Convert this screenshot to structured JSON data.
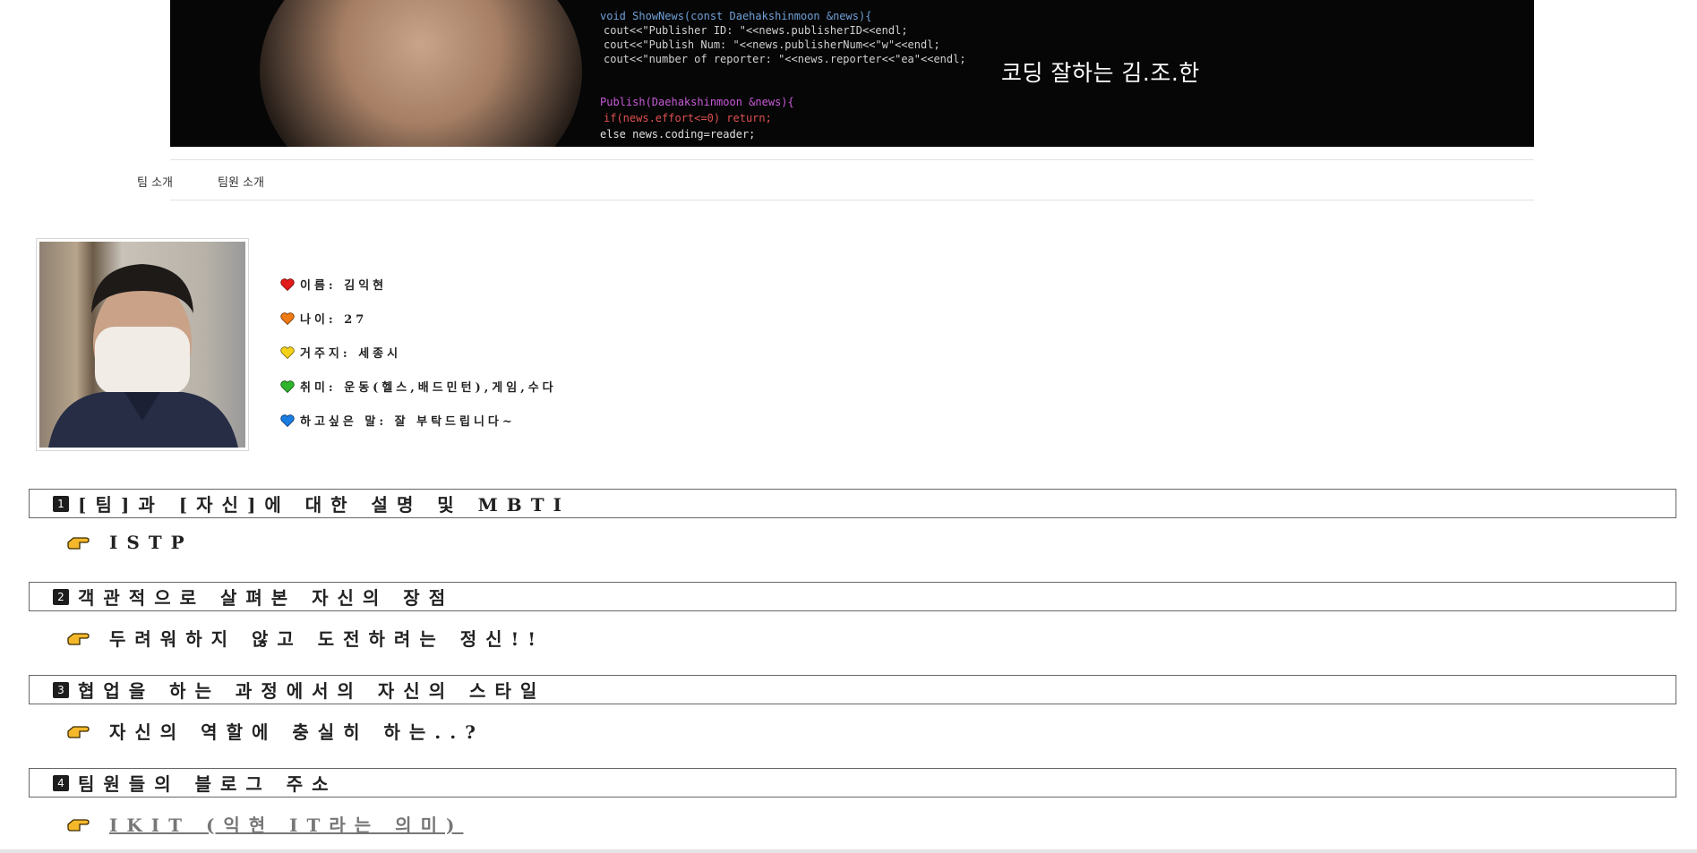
{
  "banner": {
    "title": "코딩 잘하는 김.조.한"
  },
  "code_lines": [
    "void ShowNews(const Daehakshinmoon &news){",
    "  cout<<\"Publisher ID:    \"<<news.publisherID<<endl;",
    "  cout<<\"Publish Num:    \"<<news.publisherNum<<\"w\"<<endl;",
    "  cout<<\"number of reporter:  \"<<news.reporter<<\"ea\"<<endl;",
    "Publish(Daehakshinmoon &news){",
    "  if(news.effort<=0) return;",
    "  else news.coding=reader;"
  ],
  "nav": {
    "team_intro": "팀 소개",
    "member_intro": "팀원 소개"
  },
  "profile": {
    "name": "이름: 김익현",
    "age": "나이: 27",
    "residence": "거주지: 세종시",
    "hobby": "취미: 운동(헬스,배드민턴),게임,수다",
    "message": "하고싶은 말: 잘 부탁드립니다~"
  },
  "colors": {
    "heart_red": "#e21a1a",
    "heart_orange": "#f07a14",
    "heart_yellow": "#f5d21a",
    "heart_green": "#2fb52c",
    "heart_blue": "#1a7de0",
    "hand": "#f5b82a"
  },
  "sections": [
    {
      "number": "1",
      "title": "[팀]과 [자신]에 대한 설명 및 MBTI",
      "answer": "ISTP"
    },
    {
      "number": "2",
      "title": "객관적으로 살펴본 자신의 장점",
      "answer": "두려워하지 않고 도전하려는 정신!!"
    },
    {
      "number": "3",
      "title": "협업을 하는 과정에서의 자신의 스타일",
      "answer": "자신의 역할에 충실히 하는..?"
    },
    {
      "number": "4",
      "title": "팀원들의 블로그 주소",
      "answer": "IKIT (익현 IT라는 의미)"
    }
  ],
  "icons": {
    "heart": "heart-icon",
    "hand": "pointing-hand-icon",
    "badge": "number-badge"
  }
}
